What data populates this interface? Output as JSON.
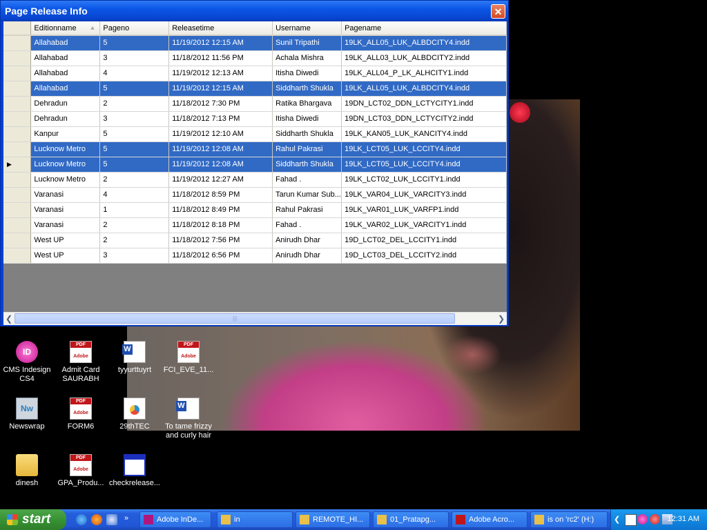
{
  "window": {
    "title": "Page Release Info",
    "close_glyph": "✕"
  },
  "grid": {
    "columns": [
      "Editionname",
      "Pageno",
      "Releasetime",
      "Username",
      "Pagename"
    ],
    "sorted_column": "Editionname",
    "rows": [
      {
        "selected": true,
        "current": false,
        "cells": [
          "Allahabad",
          "5",
          "11/19/2012 12:15 AM",
          "Sunil Tripathi",
          "19LK_ALL05_LUK_ALBDCITY4.indd"
        ]
      },
      {
        "selected": false,
        "current": false,
        "cells": [
          "Allahabad",
          "3",
          "11/18/2012 11:56 PM",
          "Achala Mishra",
          "19LK_ALL03_LUK_ALBDCITY2.indd"
        ]
      },
      {
        "selected": false,
        "current": false,
        "cells": [
          "Allahabad",
          "4",
          "11/19/2012 12:13 AM",
          "Itisha Diwedi",
          "19LK_ALL04_P_LK_ALHCITY1.indd"
        ]
      },
      {
        "selected": true,
        "current": false,
        "cells": [
          "Allahabad",
          "5",
          "11/19/2012 12:15 AM",
          "Siddharth Shukla",
          "19LK_ALL05_LUK_ALBDCITY4.indd"
        ]
      },
      {
        "selected": false,
        "current": false,
        "cells": [
          "Dehradun",
          "2",
          "11/18/2012 7:30 PM",
          "Ratika Bhargava",
          "19DN_LCT02_DDN_LCTYCITY1.indd"
        ]
      },
      {
        "selected": false,
        "current": false,
        "cells": [
          "Dehradun",
          "3",
          "11/18/2012 7:13 PM",
          "Itisha Diwedi",
          "19DN_LCT03_DDN_LCTYCITY2.indd"
        ]
      },
      {
        "selected": false,
        "current": false,
        "cells": [
          "Kanpur",
          "5",
          "11/19/2012 12:10 AM",
          "Siddharth Shukla",
          "19LK_KAN05_LUK_KANCITY4.indd"
        ]
      },
      {
        "selected": true,
        "current": false,
        "cells": [
          "Lucknow Metro",
          "5",
          "11/19/2012 12:08 AM",
          "Rahul Pakrasi",
          "19LK_LCT05_LUK_LCCITY4.indd"
        ]
      },
      {
        "selected": true,
        "current": true,
        "cells": [
          "Lucknow Metro",
          "5",
          "11/19/2012 12:08 AM",
          "Siddharth Shukla",
          "19LK_LCT05_LUK_LCCITY4.indd"
        ]
      },
      {
        "selected": false,
        "current": false,
        "cells": [
          "Lucknow Metro",
          "2",
          "11/19/2012 12:27 AM",
          "Fahad .",
          "19LK_LCT02_LUK_LCCITY1.indd"
        ]
      },
      {
        "selected": false,
        "current": false,
        "cells": [
          "Varanasi",
          "4",
          "11/18/2012 8:59 PM",
          "Tarun Kumar Sub...",
          "19LK_VAR04_LUK_VARCITY3.indd"
        ]
      },
      {
        "selected": false,
        "current": false,
        "cells": [
          "Varanasi",
          "1",
          "11/18/2012 8:49 PM",
          "Rahul Pakrasi",
          "19LK_VAR01_LUK_VARFP1.indd"
        ]
      },
      {
        "selected": false,
        "current": false,
        "cells": [
          "Varanasi",
          "2",
          "11/18/2012 8:18 PM",
          "Fahad .",
          "19LK_VAR02_LUK_VARCITY1.indd"
        ]
      },
      {
        "selected": false,
        "current": false,
        "cells": [
          "West UP",
          "2",
          "11/18/2012 7:56 PM",
          "Anirudh Dhar",
          "19D_LCT02_DEL_LCCITY1.indd"
        ]
      },
      {
        "selected": false,
        "current": false,
        "cells": [
          "West UP",
          "3",
          "11/18/2012 6:56 PM",
          "Anirudh Dhar",
          "19D_LCT03_DEL_LCCITY2.indd"
        ]
      }
    ]
  },
  "desktop_icons": [
    {
      "name": "cms-indesign-icon",
      "label": "CMS Indesign CS4",
      "kind": "indd",
      "glyph": "ID"
    },
    {
      "name": "admit-card-icon",
      "label": "Admit Card SAURABH",
      "kind": "pdf",
      "glyph": ""
    },
    {
      "name": "tyyurttuyrt-icon",
      "label": "tyyurttuyrt",
      "kind": "doc",
      "glyph": ""
    },
    {
      "name": "fci-eve-icon",
      "label": "FCI_EVE_11...",
      "kind": "pdf",
      "glyph": ""
    },
    {
      "name": "newswrap-icon",
      "label": "Newswrap",
      "kind": "nw",
      "glyph": "Nw"
    },
    {
      "name": "form6-icon",
      "label": "FORM6",
      "kind": "pdf",
      "glyph": ""
    },
    {
      "name": "29thtec-icon",
      "label": "29thTEC",
      "kind": "tec",
      "glyph": ""
    },
    {
      "name": "to-tame-frizzy-icon",
      "label": "To tame frizzy and curly hair",
      "kind": "doc",
      "glyph": ""
    },
    {
      "name": "dinesh-folder-icon",
      "label": "dinesh",
      "kind": "folder",
      "glyph": ""
    },
    {
      "name": "gpa-produ-icon",
      "label": "GPA_Produ...",
      "kind": "pdf",
      "glyph": ""
    },
    {
      "name": "checkrelease-icon",
      "label": "checkrelease...",
      "kind": "app",
      "glyph": ""
    }
  ],
  "taskbar": {
    "start_label": "start",
    "chevron": "»",
    "tasks": [
      {
        "label": "Adobe InDe...",
        "icon_color": "#b0177d"
      },
      {
        "label": "in",
        "icon_color": "#e8c04a"
      },
      {
        "label": "REMOTE_HI...",
        "icon_color": "#e8c04a"
      },
      {
        "label": "01_Pratapg...",
        "icon_color": "#e8c04a"
      },
      {
        "label": "Adobe Acro...",
        "icon_color": "#c0161a"
      },
      {
        "label": "is on 'rc2' (H:)",
        "icon_color": "#e8c04a"
      }
    ],
    "tray_expand": "❮",
    "clock": "12:31 AM"
  },
  "colors": {
    "selection": "#316ac5",
    "titlebar": "#0b56e6",
    "taskbar": "#245edb",
    "start": "#379333"
  }
}
